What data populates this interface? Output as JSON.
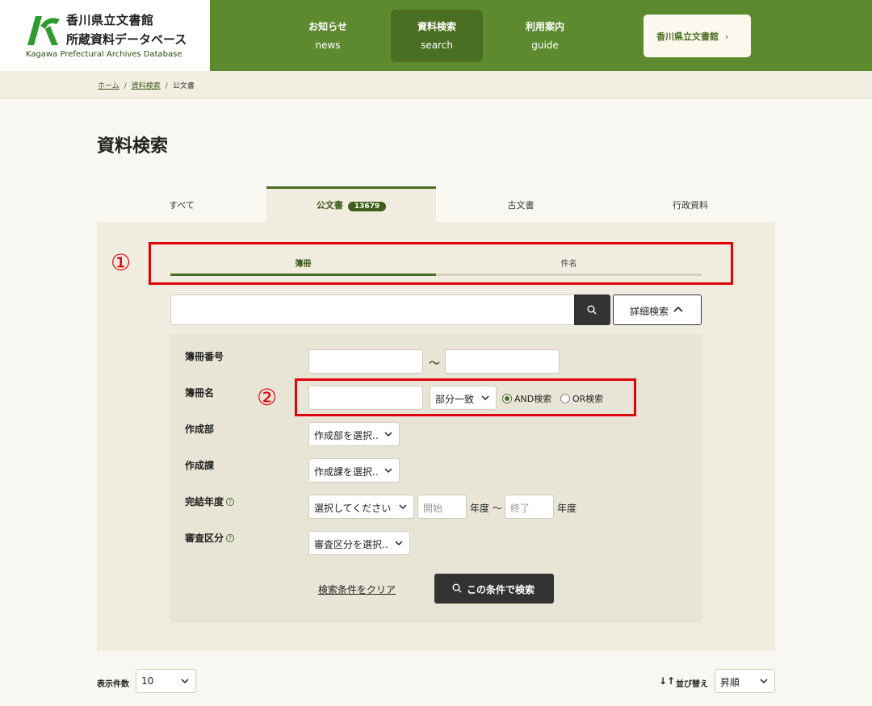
{
  "site": {
    "title_line1": "香川県立文書館",
    "title_line2": "所蔵資料データベース",
    "title_en": "Kagawa Prefectural Archives Database"
  },
  "nav": {
    "items": [
      {
        "jp": "お知らせ",
        "en": "news"
      },
      {
        "jp": "資料検索",
        "en": "search"
      },
      {
        "jp": "利用案内",
        "en": "guide"
      }
    ],
    "external_button": "香川県立文書館",
    "external_chevron": "›"
  },
  "breadcrumb": {
    "home": "ホーム",
    "search": "資料検索",
    "current": "公文書",
    "separator": "/"
  },
  "page_title": "資料検索",
  "category_tabs": {
    "all": "すべて",
    "official": "公文書",
    "official_count": "13679",
    "old": "古文書",
    "admin": "行政資料"
  },
  "sub_tabs": {
    "ledger": "簿冊",
    "item": "件名"
  },
  "annotations": {
    "mark1": "①",
    "mark2": "②",
    "color": "#e0000c"
  },
  "keyword_search": {
    "value": "",
    "advanced_label": "詳細検索"
  },
  "advanced_form": {
    "ledger_number_label": "簿冊番号",
    "range_sep": "〜",
    "ledger_name_label": "簿冊名",
    "match_mode": "部分一致",
    "and_label": "AND検索",
    "or_label": "OR検索",
    "dept_label": "作成部",
    "dept_select": "作成部を選択..",
    "section_label": "作成課",
    "section_select": "作成課を選択..",
    "year_label": "完結年度",
    "year_select": "選択してください",
    "year_start_placeholder": "開始",
    "year_unit": "年度 〜",
    "year_end_placeholder": "終了",
    "year_unit_end": "年度",
    "review_label": "審査区分",
    "review_select": "審査区分を選択..",
    "help_glyph": "?",
    "clear_label": "検索条件をクリア",
    "submit_label": "この条件で検索"
  },
  "list_controls": {
    "per_page_label": "表示件数",
    "per_page_value": "10",
    "sort_icon": "↓↑",
    "sort_label": "並び替え",
    "sort_value": "昇順"
  },
  "colors": {
    "brand_green": "#5e8a2f",
    "dark_green": "#4a6e22",
    "panel_bg": "#f0ecdf",
    "button_dark": "#333333"
  }
}
